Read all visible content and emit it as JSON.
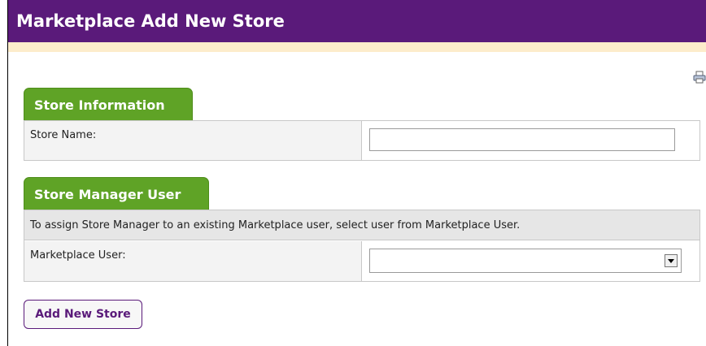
{
  "header": {
    "title": "Marketplace Add New Store"
  },
  "toolbar": {
    "print_icon": "printer-icon"
  },
  "store_information": {
    "tab_label": "Store Information",
    "store_name_label": "Store Name:",
    "store_name_value": ""
  },
  "store_manager_user": {
    "tab_label": "Store Manager User",
    "info_text": "To assign Store Manager to an existing Marketplace user, select user from Marketplace User.",
    "marketplace_user_label": "Marketplace User:",
    "marketplace_user_selected": ""
  },
  "actions": {
    "add_new_store_label": "Add New Store"
  },
  "colors": {
    "header_bg": "#5a1a7a",
    "header_strip": "#fdeccb",
    "tab_bg": "#5fa326",
    "button_border": "#5a1a7a"
  }
}
